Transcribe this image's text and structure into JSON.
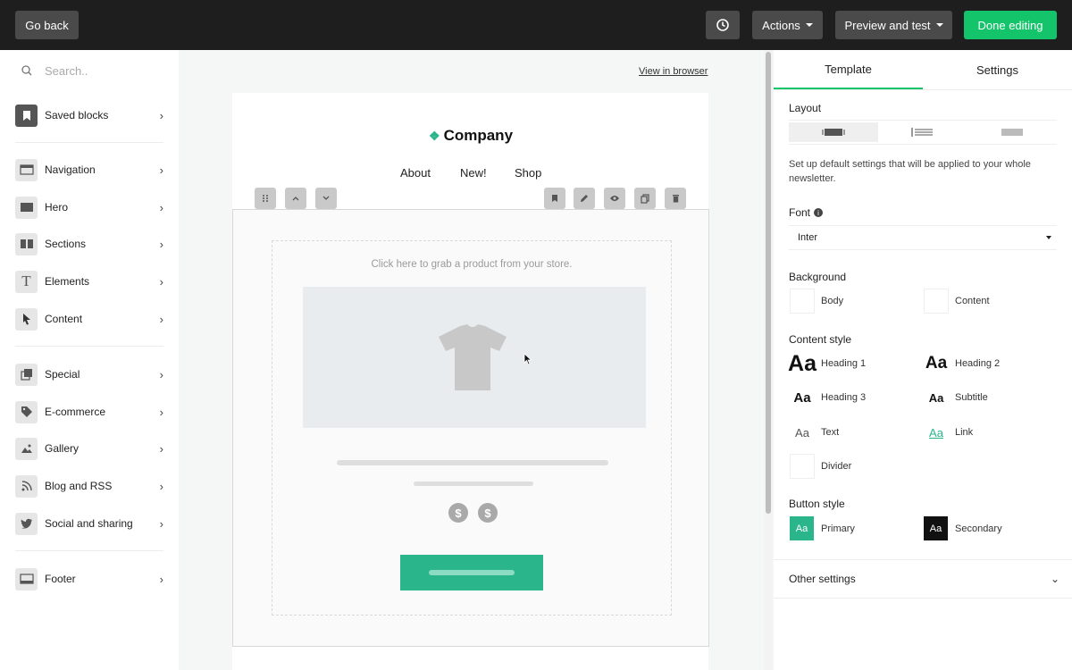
{
  "topbar": {
    "go_back": "Go back",
    "actions": "Actions",
    "preview": "Preview and test",
    "done": "Done editing"
  },
  "sidebar": {
    "search_placeholder": "Search..",
    "items": [
      {
        "label": "Saved blocks"
      },
      {
        "label": "Navigation"
      },
      {
        "label": "Hero"
      },
      {
        "label": "Sections"
      },
      {
        "label": "Elements"
      },
      {
        "label": "Content"
      },
      {
        "label": "Special"
      },
      {
        "label": "E-commerce"
      },
      {
        "label": "Gallery"
      },
      {
        "label": "Blog and RSS"
      },
      {
        "label": "Social and sharing"
      },
      {
        "label": "Footer"
      }
    ]
  },
  "canvas": {
    "view_in_browser": "View in browser",
    "company": "Company",
    "nav": [
      "About",
      "New!",
      "Shop"
    ],
    "grab_text": "Click here to grab a product from your store.",
    "currency_symbol": "$"
  },
  "panel": {
    "tabs": [
      "Template",
      "Settings"
    ],
    "layout_label": "Layout",
    "description": "Set up default settings that will be applied to your whole newsletter.",
    "font_label": "Font",
    "font_value": "Inter",
    "background_label": "Background",
    "bg_body": "Body",
    "bg_content": "Content",
    "content_style_label": "Content style",
    "styles": {
      "heading1": "Heading 1",
      "heading2": "Heading 2",
      "heading3": "Heading 3",
      "subtitle": "Subtitle",
      "text": "Text",
      "link": "Link",
      "divider": "Divider"
    },
    "aa": "Aa",
    "button_style_label": "Button style",
    "primary": "Primary",
    "secondary": "Secondary",
    "other_settings": "Other settings"
  },
  "colors": {
    "accent": "#14c46b",
    "brand_green": "#2ab58b"
  }
}
